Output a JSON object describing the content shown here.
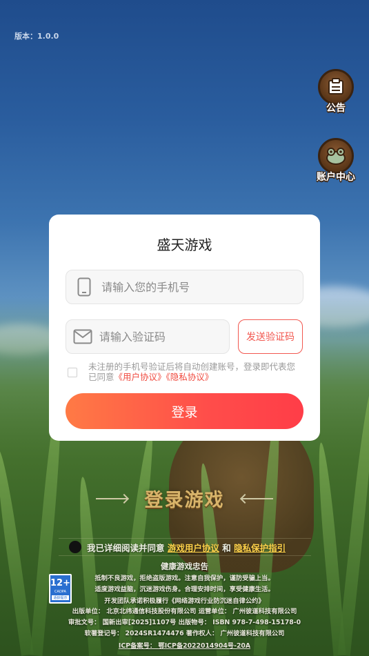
{
  "version_text": "版本：1.0.0",
  "side_buttons": {
    "announcement": "公告",
    "account_center": "账户中心"
  },
  "login_modal": {
    "title": "盛天游戏",
    "phone_placeholder": "请输入您的手机号",
    "code_placeholder": "请输入验证码",
    "send_code_label": "发送验证码",
    "agreement_prefix": "未注册的手机号验证后将自动创建账号，登录即代表您已同意",
    "user_agreement_link": "《用户协议》",
    "privacy_agreement_link": "《隐私协议》",
    "login_label": "登录"
  },
  "game_login_label": "登录游戏",
  "agreement_bar": {
    "prefix": "我已详细阅读并同意",
    "game_agreement": "游戏用户协议",
    "and": "和",
    "privacy_guide": "隐私保护指引"
  },
  "age_badge": {
    "rating": "12+",
    "label": "CADPA",
    "sub": "适龄提示"
  },
  "footer": {
    "health_title": "健康游戏忠告",
    "line1": "抵制不良游戏，拒绝盗版游戏。注意自我保护，谨防受骗上当。",
    "line2": "适度游戏益脑，沉迷游戏伤身。合理安排时间，享受健康生活。",
    "line3": "开发团队承诺积极履行《网络游戏行业防沉迷自律公约》",
    "line4": "出版单位：  北京北纬通信科技股份有限公司   运营单位：  广州彼道科技有限公司",
    "line5": "审批文号：  国新出审[2025]1107号   出版物号：  ISBN 978-7-498-15178-0",
    "line6": "软著登记号：  2024SR1474476   著作权人：  广州彼道科技有限公司",
    "icp": "ICP备案号：  鄂ICP备2022014904号-20A"
  }
}
